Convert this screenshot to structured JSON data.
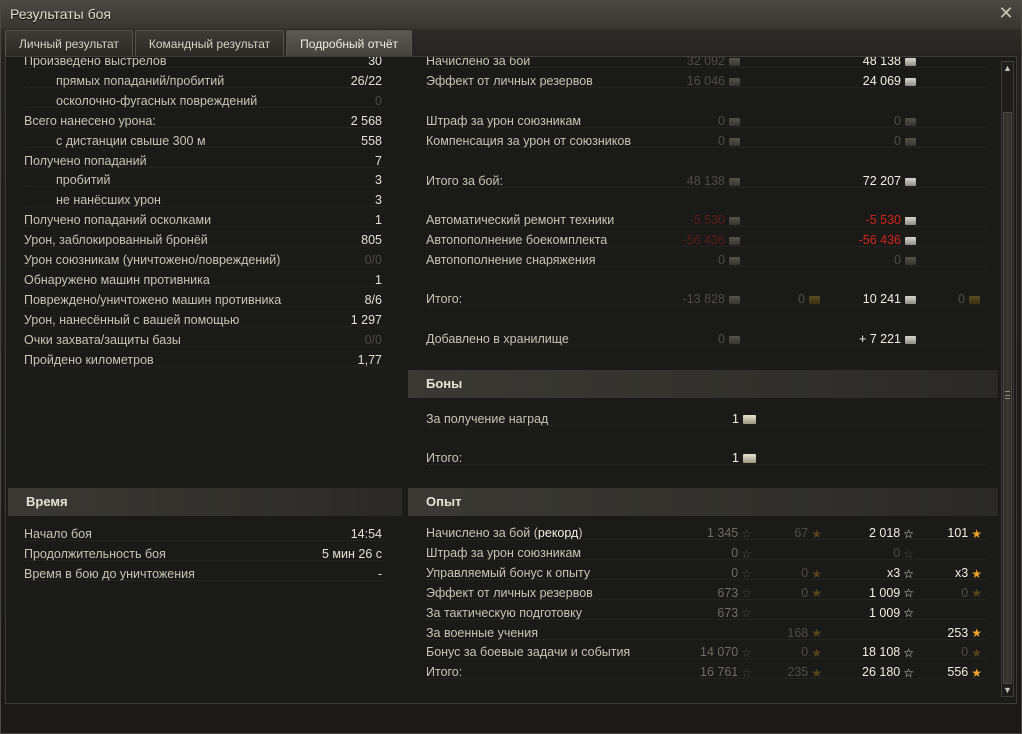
{
  "window": {
    "title": "Результаты боя"
  },
  "tabs": [
    "Личный результат",
    "Командный результат",
    "Подробный отчёт"
  ],
  "left_stats": [
    {
      "label": "Произведено выстрелов",
      "value": "30",
      "indent": false,
      "dim": false
    },
    {
      "label": "прямых попаданий/пробитий",
      "value": "26/22",
      "indent": true,
      "dim": false
    },
    {
      "label": "осколочно-фугасных повреждений",
      "value": "0",
      "indent": true,
      "dim": true
    },
    {
      "label": "Всего нанесено урона:",
      "value": "2 568",
      "indent": false,
      "dim": false
    },
    {
      "label": "с дистанции свыше 300 м",
      "value": "558",
      "indent": true,
      "dim": false
    },
    {
      "label": "Получено попаданий",
      "value": "7",
      "indent": false,
      "dim": false
    },
    {
      "label": "пробитий",
      "value": "3",
      "indent": true,
      "dim": false
    },
    {
      "label": "не нанёсших урон",
      "value": "3",
      "indent": true,
      "dim": false
    },
    {
      "label": "Получено попаданий осколками",
      "value": "1",
      "indent": false,
      "dim": false
    },
    {
      "label": "Урон, заблокированный бронёй",
      "value": "805",
      "indent": false,
      "dim": false
    },
    {
      "label": "Урон союзникам (уничтожено/повреждений)",
      "value": "0/0",
      "indent": false,
      "dim": true
    },
    {
      "label": "Обнаружено машин противника",
      "value": "1",
      "indent": false,
      "dim": false
    },
    {
      "label": "Повреждено/уничтожено машин противника",
      "value": "8/6",
      "indent": false,
      "dim": false
    },
    {
      "label": "Урон, нанесённый с вашей помощью",
      "value": "1 297",
      "indent": false,
      "dim": false
    },
    {
      "label": "Очки захвата/защиты базы",
      "value": "0/0",
      "indent": false,
      "dim": true
    },
    {
      "label": "Пройдено километров",
      "value": "1,77",
      "indent": false,
      "dim": false
    }
  ],
  "time_section": {
    "title": "Время",
    "rows": [
      {
        "label": "Начало боя",
        "value": "14:54"
      },
      {
        "label": "Продолжительность боя",
        "value": "5 мин 26 с"
      },
      {
        "label": "Время в бою до уничтожения",
        "value": "-"
      }
    ]
  },
  "credits": [
    {
      "label": "Начислено за бой",
      "c1": "32 092",
      "c2": "",
      "c3": "48 138",
      "c4": ""
    },
    {
      "label": "Эффект от личных резервов",
      "c1": "16 046",
      "c2": "",
      "c3": "24 069",
      "c4": ""
    },
    {
      "label": "Штраф за урон союзникам",
      "c1": "0",
      "c2": "",
      "c3": "0",
      "c4": ""
    },
    {
      "label": "Компенсация за урон от союзников",
      "c1": "0",
      "c2": "",
      "c3": "0",
      "c4": ""
    },
    {
      "label": "Итого за бой:",
      "c1": "48 138",
      "c2": "",
      "c3": "72 207",
      "c4": ""
    },
    {
      "label": "Автоматический ремонт техники",
      "c1": "-5 530",
      "c2": "",
      "c3": "-5 530",
      "c4": ""
    },
    {
      "label": "Автопополнение боекомплекта",
      "c1": "-56 436",
      "c2": "",
      "c3": "-56 436",
      "c4": ""
    },
    {
      "label": "Автопополнение снаряжения",
      "c1": "0",
      "c2": "",
      "c3": "0",
      "c4": ""
    },
    {
      "label": "Итого:",
      "c1": "-13 828",
      "c2": "0",
      "c3": "10 241",
      "c4": "0"
    },
    {
      "label": "Добавлено в хранилище",
      "c1": "0",
      "c2": "",
      "c3": "+ 7 221",
      "c4": ""
    }
  ],
  "bonds": {
    "title": "Боны",
    "rows": [
      {
        "label": "За получение наград",
        "value": "1"
      },
      {
        "label": "Итого:",
        "value": "1"
      }
    ]
  },
  "experience": {
    "title": "Опыт",
    "record_label": "рекорд",
    "rows": [
      {
        "label": "Начислено за бой (",
        "c1": "1 345",
        "c2": "67",
        "c3": "2 018",
        "c4": "101"
      },
      {
        "label": "Штраф за урон союзникам",
        "c1": "0",
        "c2": "",
        "c3": "0",
        "c4": ""
      },
      {
        "label": "Управляемый бонус к опыту",
        "c1": "0",
        "c2": "0",
        "c3": "x3",
        "c4": "x3"
      },
      {
        "label": "Эффект от личных резервов",
        "c1": "673",
        "c2": "0",
        "c3": "1 009",
        "c4": "0"
      },
      {
        "label": "За тактическую подготовку",
        "c1": "673",
        "c2": "",
        "c3": "1 009",
        "c4": ""
      },
      {
        "label": "За военные учения",
        "c1": "",
        "c2": "168",
        "c3": "",
        "c4": "253"
      },
      {
        "label": "Бонус за боевые задачи и события",
        "c1": "14 070",
        "c2": "0",
        "c3": "18 108",
        "c4": "0"
      },
      {
        "label": "Итого:",
        "c1": "16 761",
        "c2": "235",
        "c3": "26 180",
        "c4": "556"
      }
    ]
  },
  "icons": {
    "close": "close-icon",
    "credit": "credit-icon",
    "gold": "gold-icon",
    "bond": "bond-icon",
    "xp": "xp-star-icon",
    "free_xp": "free-xp-star-icon"
  }
}
